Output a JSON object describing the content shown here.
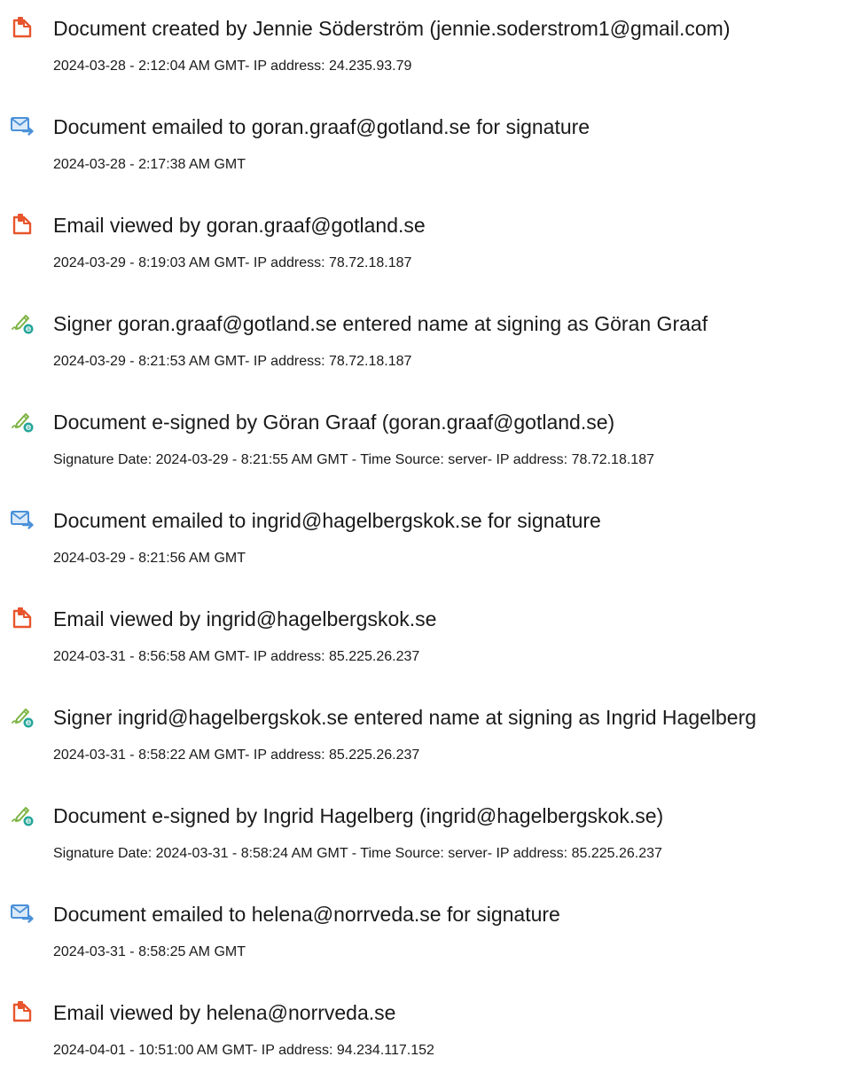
{
  "events": [
    {
      "icon": "document-created-icon",
      "title": "Document created by Jennie Söderström (jennie.soderstrom1@gmail.com)",
      "meta": "2024-03-28 - 2:12:04 AM GMT- IP address: 24.235.93.79"
    },
    {
      "icon": "email-sent-icon",
      "title": "Document emailed to goran.graaf@gotland.se for signature",
      "meta": "2024-03-28 - 2:17:38 AM GMT"
    },
    {
      "icon": "email-viewed-icon",
      "title": "Email viewed by goran.graaf@gotland.se",
      "meta": "2024-03-29 - 8:19:03 AM GMT- IP address: 78.72.18.187"
    },
    {
      "icon": "e-sign-icon",
      "title": "Signer goran.graaf@gotland.se entered name at signing as Göran Graaf",
      "meta": "2024-03-29 - 8:21:53 AM GMT- IP address: 78.72.18.187"
    },
    {
      "icon": "e-sign-icon",
      "title": "Document e-signed by Göran Graaf (goran.graaf@gotland.se)",
      "meta": "Signature Date: 2024-03-29 - 8:21:55 AM GMT - Time Source: server- IP address: 78.72.18.187"
    },
    {
      "icon": "email-sent-icon",
      "title": "Document emailed to ingrid@hagelbergskok.se for signature",
      "meta": "2024-03-29 - 8:21:56 AM GMT"
    },
    {
      "icon": "email-viewed-icon",
      "title": "Email viewed by ingrid@hagelbergskok.se",
      "meta": "2024-03-31 - 8:56:58 AM GMT- IP address: 85.225.26.237"
    },
    {
      "icon": "e-sign-icon",
      "title": "Signer ingrid@hagelbergskok.se entered name at signing as Ingrid Hagelberg",
      "meta": "2024-03-31 - 8:58:22 AM GMT- IP address: 85.225.26.237"
    },
    {
      "icon": "e-sign-icon",
      "title": "Document e-signed by Ingrid Hagelberg (ingrid@hagelbergskok.se)",
      "meta": "Signature Date: 2024-03-31 - 8:58:24 AM GMT - Time Source: server- IP address: 85.225.26.237"
    },
    {
      "icon": "email-sent-icon",
      "title": "Document emailed to helena@norrveda.se for signature",
      "meta": "2024-03-31 - 8:58:25 AM GMT"
    },
    {
      "icon": "email-viewed-icon",
      "title": "Email viewed by helena@norrveda.se",
      "meta": "2024-04-01 - 10:51:00 AM GMT- IP address: 94.234.117.152"
    }
  ],
  "colors": {
    "document_icon": "#e8552d",
    "email_icon": "#4a90d9",
    "sign_icon_pen": "#7cb342",
    "sign_icon_badge": "#26a69a",
    "text": "#1a1a1a"
  }
}
